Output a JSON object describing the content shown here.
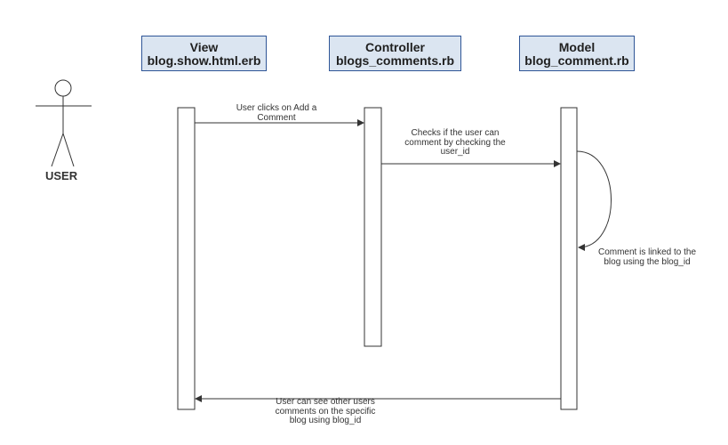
{
  "participants": {
    "view": {
      "title": "View",
      "file": "blog.show.html.erb"
    },
    "controller": {
      "title": "Controller",
      "file": "blogs_comments.rb"
    },
    "model": {
      "title": "Model",
      "file": "blog_comment.rb"
    }
  },
  "actor": {
    "label": "USER"
  },
  "messages": {
    "m1": {
      "line1": "User clicks on Add a",
      "line2": "Comment"
    },
    "m2": {
      "line1": "Checks if the user can",
      "line2": "comment by checking the",
      "line3": "user_id"
    },
    "m3": {
      "line1": "Comment is linked to the",
      "line2": "blog using the blog_id"
    },
    "m4": {
      "line1": "User can see other users",
      "line2": "comments on the specific",
      "line3": "blog using blog_id"
    }
  },
  "colors": {
    "header_fill": "#dbe5f1",
    "header_border": "#2f5597",
    "line": "#333333"
  }
}
